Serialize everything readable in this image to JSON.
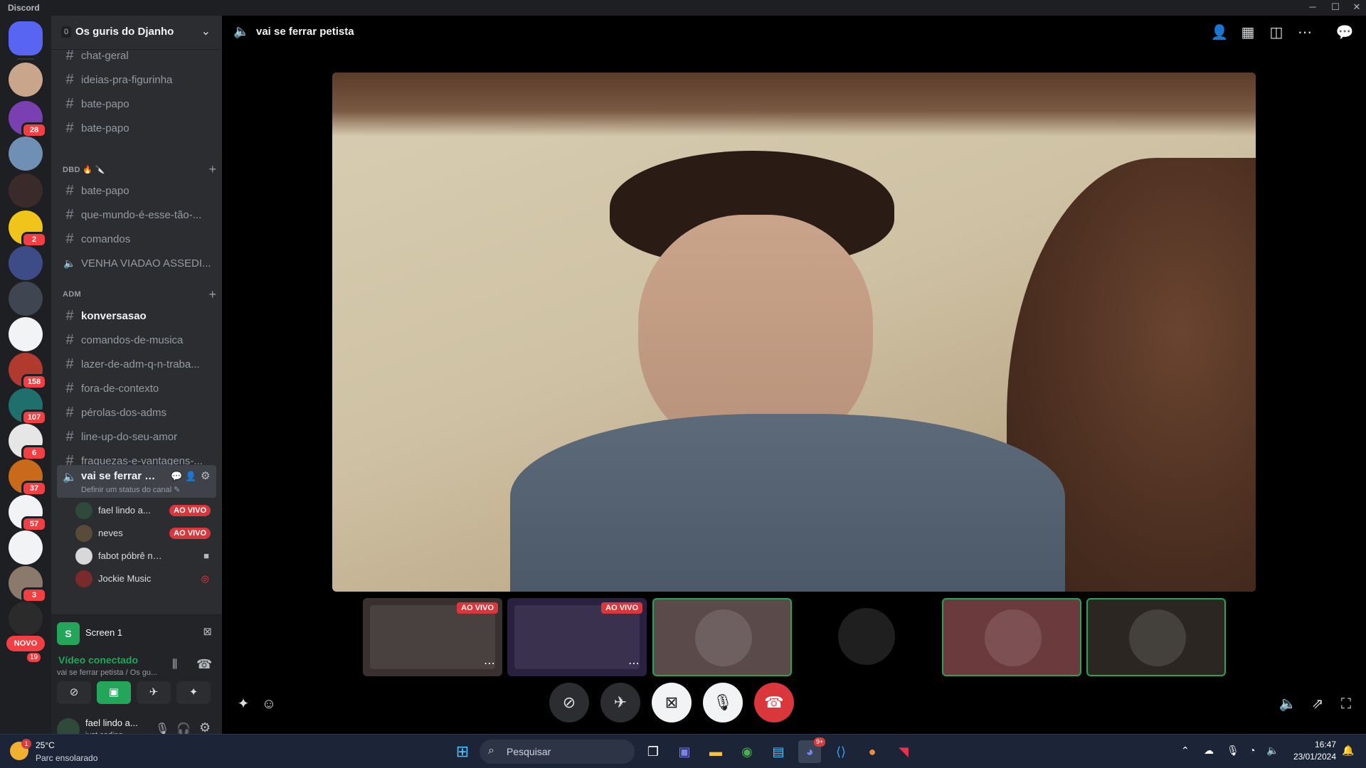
{
  "window": {
    "app_title": "Discord",
    "controls": {
      "minimize": "─",
      "maximize": "☐",
      "close": "✕"
    }
  },
  "servers": [
    {
      "name": "discord-home",
      "badge": "",
      "color": "#5865f2"
    },
    {
      "name": "server-1",
      "badge": "",
      "color": "#c9a58c"
    },
    {
      "name": "server-2",
      "badge": "28",
      "color": "#7a3fb0"
    },
    {
      "name": "server-3",
      "badge": "",
      "color": "#6f8fb5"
    },
    {
      "name": "server-4",
      "badge": "",
      "color": "#3b2a2a"
    },
    {
      "name": "server-5",
      "badge": "2",
      "color": "#f0c419"
    },
    {
      "name": "server-6",
      "badge": "",
      "color": "#3d4c86"
    },
    {
      "name": "server-7",
      "badge": "",
      "color": "#404552"
    },
    {
      "name": "server-8",
      "badge": "",
      "color": "#f2f3f5"
    },
    {
      "name": "server-9",
      "badge": "158",
      "color": "#b03a2e"
    },
    {
      "name": "server-10",
      "badge": "107",
      "color": "#1f6f6d"
    },
    {
      "name": "server-11",
      "badge": "6",
      "color": "#e6e6e6"
    },
    {
      "name": "server-12",
      "badge": "37",
      "color": "#c96a1a"
    },
    {
      "name": "server-13",
      "badge": "57",
      "color": "#f2f3f5"
    },
    {
      "name": "server-14",
      "badge": "",
      "color": "#f2f3f5"
    },
    {
      "name": "server-15",
      "badge": "3",
      "color": "#8b7a6b"
    },
    {
      "name": "server-16",
      "badge": "",
      "color": "#2b2b2b"
    }
  ],
  "server_new_label": "NOVO",
  "server_new_count": "19",
  "guild": {
    "name": "Os guris do Djanho",
    "badge": "0"
  },
  "channels_top": [
    {
      "name": "chat-geral"
    },
    {
      "name": "ideias-pra-figurinha"
    },
    {
      "name": "bate-papo"
    },
    {
      "name": "bate-papo"
    }
  ],
  "category_dbd": {
    "label": "DBD 🔥 🔪",
    "channels": [
      {
        "name": "bate-papo",
        "icon": "#"
      },
      {
        "name": "que-mundo-é-esse-tão-...",
        "icon": "#"
      },
      {
        "name": "comandos",
        "icon": "#"
      },
      {
        "name": "VENHA VIADAO ASSEDI...",
        "icon": "🔊"
      }
    ]
  },
  "category_adm": {
    "label": "ADM",
    "channels": [
      {
        "name": "konversasao",
        "bright": true
      },
      {
        "name": "comandos-de-musica"
      },
      {
        "name": "lazer-de-adm-q-n-traba..."
      },
      {
        "name": "fora-de-contexto"
      },
      {
        "name": "pérolas-dos-adms"
      },
      {
        "name": "line-up-do-seu-amor"
      },
      {
        "name": "fraquezas-e-vantagens-..."
      }
    ]
  },
  "voice_channel": {
    "name": "vai se ferrar pet...",
    "status_hint": "Definir um status do canal ✎"
  },
  "voice_users": [
    {
      "name": "fael lindo a...",
      "live": "AO VIVO",
      "avatar_color": "#2f4a3a"
    },
    {
      "name": "neves",
      "live": "AO VIVO",
      "avatar_color": "#5a4a3a"
    },
    {
      "name": "fabot póbrê nórdes...",
      "live": "",
      "avatar_color": "#d8d8d8"
    },
    {
      "name": "Jockie Music",
      "live": "",
      "avatar_color": "#7a2a2a"
    }
  ],
  "stream_card": {
    "badge": "S",
    "title": "Screen 1"
  },
  "rtc": {
    "status": "Vídeo conectado",
    "location": "vai se ferrar petista / Os gu..."
  },
  "user_panel": {
    "name": "fael lindo a...",
    "status": "just coding"
  },
  "main": {
    "title": "vai se ferrar petista",
    "tiles": [
      {
        "name": "tile-screen-share",
        "live": "AO VIVO",
        "color": "#3a3030",
        "green": false
      },
      {
        "name": "tile-valorant-stream",
        "live": "AO VIVO",
        "color": "#2a2040",
        "green": false
      },
      {
        "name": "tile-user-camera",
        "live": "",
        "color": "#5a4a4a",
        "green": true
      },
      {
        "name": "tile-nah-avatar",
        "live": "",
        "color": "#000000",
        "green": false
      },
      {
        "name": "tile-music-bot",
        "live": "",
        "color": "#6b3a3c",
        "green": true
      },
      {
        "name": "tile-user-avatar",
        "live": "",
        "color": "#2b2622",
        "green": true
      }
    ]
  },
  "taskbar": {
    "weather_temp": "25°C",
    "weather_status": "Parc ensolarado",
    "weather_badge": "1",
    "search_placeholder": "Pesquisar",
    "discord_badge": "9+",
    "time": "16:47",
    "date": "23/01/2024"
  },
  "colors": {
    "accent": "#5865f2",
    "online": "#23a55a",
    "danger": "#da373c"
  }
}
